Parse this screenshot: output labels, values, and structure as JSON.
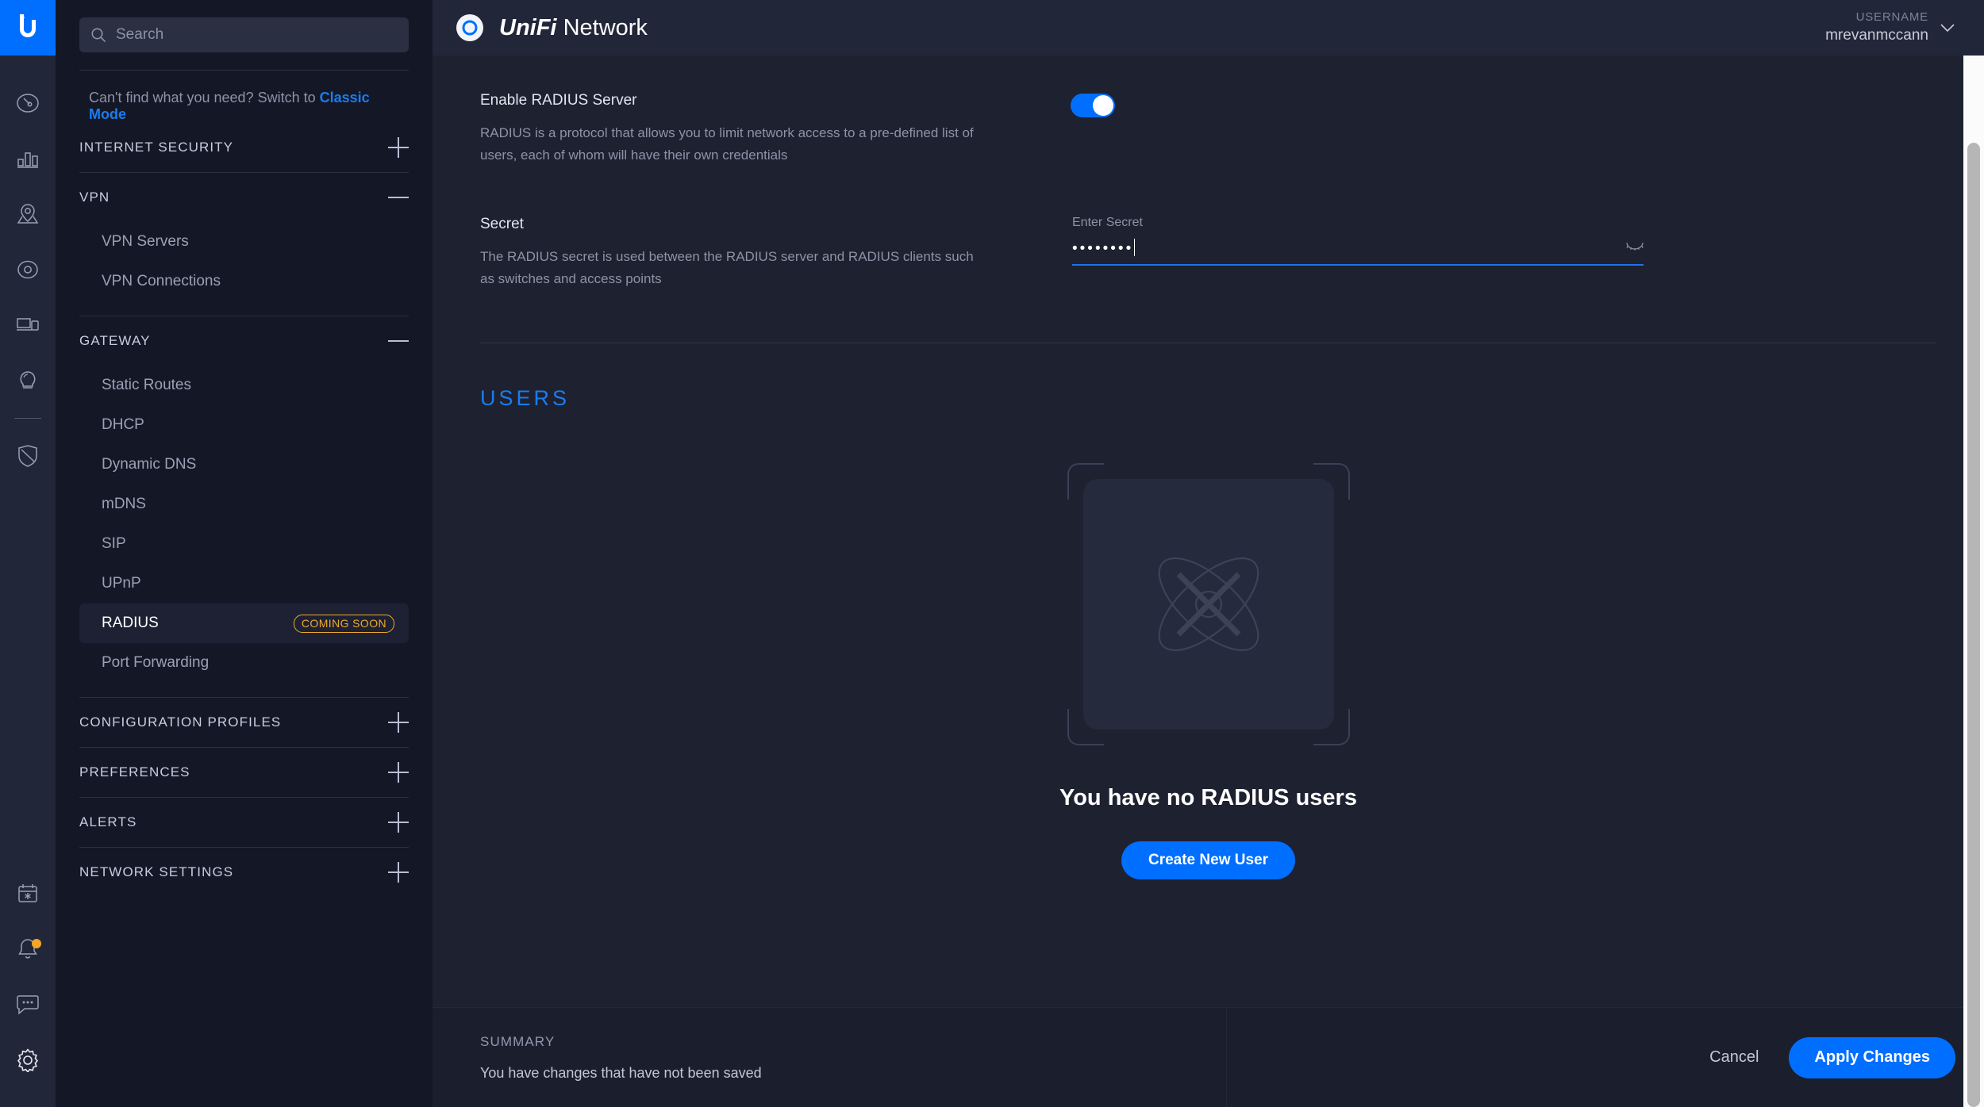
{
  "header": {
    "product_prefix": "UniFi",
    "product_suffix": "Network",
    "user_label": "USERNAME",
    "user_name": "mrevanmccann"
  },
  "sidebar": {
    "search_placeholder": "Search",
    "classic_prompt": "Can't find what you need? Switch to",
    "classic_link": "Classic Mode",
    "sections": [
      {
        "title": "INTERNET SECURITY",
        "state": "collapsed",
        "toggle": "+"
      },
      {
        "title": "VPN",
        "state": "expanded",
        "toggle": "−"
      },
      {
        "title": "GATEWAY",
        "state": "expanded",
        "toggle": "−"
      },
      {
        "title": "CONFIGURATION PROFILES",
        "state": "collapsed",
        "toggle": "+"
      },
      {
        "title": "PREFERENCES",
        "state": "collapsed",
        "toggle": "+"
      },
      {
        "title": "ALERTS",
        "state": "collapsed",
        "toggle": "+"
      },
      {
        "title": "NETWORK SETTINGS",
        "state": "collapsed",
        "toggle": "+"
      }
    ],
    "vpn_items": [
      {
        "label": "VPN Servers"
      },
      {
        "label": "VPN Connections"
      }
    ],
    "gateway_items": [
      {
        "label": "Static Routes",
        "badge": ""
      },
      {
        "label": "DHCP",
        "badge": ""
      },
      {
        "label": "Dynamic DNS",
        "badge": ""
      },
      {
        "label": "mDNS",
        "badge": ""
      },
      {
        "label": "SIP",
        "badge": ""
      },
      {
        "label": "UPnP",
        "badge": ""
      },
      {
        "label": "RADIUS",
        "badge": "COMING SOON"
      },
      {
        "label": "Port Forwarding",
        "badge": ""
      }
    ]
  },
  "main": {
    "enable": {
      "label": "Enable RADIUS Server",
      "description": "RADIUS is a protocol that allows you to limit network access to a pre-defined list of users, each of whom will have their own credentials",
      "toggle_state": "on"
    },
    "secret": {
      "label": "Secret",
      "description": "The RADIUS secret is used between the RADIUS server and RADIUS clients such as switches and access points",
      "field_label": "Enter Secret",
      "value": "••••••••",
      "placeholder": "Enter Secret"
    },
    "users_heading": "USERS",
    "empty_state": {
      "message": "You have no RADIUS users",
      "button": "Create New User"
    }
  },
  "footer": {
    "kicker": "SUMMARY",
    "message": "You have changes that have not been saved",
    "cancel": "Cancel",
    "apply": "Apply Changes"
  },
  "colors": {
    "accent": "#006fff",
    "link": "#1b7ced",
    "warning": "#f0a92b",
    "notification": "#f5a623"
  }
}
